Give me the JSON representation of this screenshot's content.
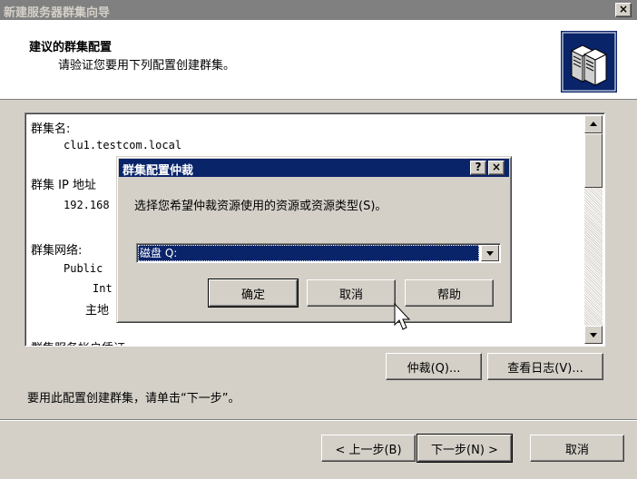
{
  "window": {
    "title": "新建服务器群集向导",
    "close": "×"
  },
  "header": {
    "title": "建议的群集配置",
    "subtitle": "请验证您要用下列配置创建群集。",
    "icon": "server-cluster-icon"
  },
  "summary": {
    "lines": [
      "群集名:",
      "clu1.testcom.local",
      "群集 IP 地址",
      "192.168",
      "群集网络:",
      "Public",
      "Int",
      "主地",
      "群集服务帐户凭证"
    ]
  },
  "actions": {
    "quorum": "仲裁(Q)...",
    "view_log": "查看日志(V)..."
  },
  "instruction": "要用此配置创建群集，请单击“下一步”。",
  "nav": {
    "back": "< 上一步(B)",
    "next": "下一步(N) >",
    "cancel": "取消"
  },
  "dialog": {
    "title": "群集配置仲裁",
    "help_btn": "?",
    "close_btn": "×",
    "prompt": "选择您希望仲裁资源使用的资源或资源类型(S)。",
    "selected_value": "磁盘 Q:",
    "ok": "确定",
    "cancel": "取消",
    "help": "帮助"
  },
  "colors": {
    "title_inactive": "#808080",
    "title_active": "#0a246a",
    "face": "#d4d0c8"
  }
}
